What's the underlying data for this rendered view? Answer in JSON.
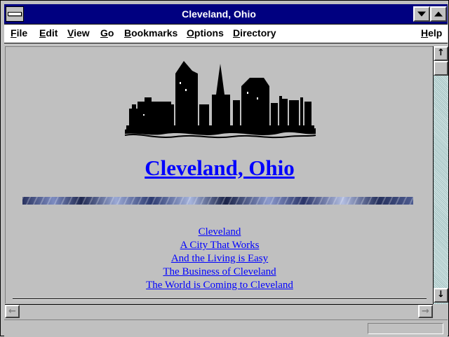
{
  "window": {
    "title": "Cleveland, Ohio"
  },
  "menubar": {
    "items": [
      {
        "label": "File",
        "accel": "F",
        "rest": "ile"
      },
      {
        "label": "Edit",
        "accel": "E",
        "rest": "dit"
      },
      {
        "label": "View",
        "accel": "V",
        "rest": "iew"
      },
      {
        "label": "Go",
        "accel": "G",
        "rest": "o"
      },
      {
        "label": "Bookmarks",
        "accel": "B",
        "rest": "ookmarks"
      },
      {
        "label": "Options",
        "accel": "O",
        "rest": "ptions"
      },
      {
        "label": "Directory",
        "accel": "D",
        "rest": "irectory"
      },
      {
        "label": "Help",
        "accel": "H",
        "rest": "elp"
      }
    ]
  },
  "page": {
    "heading": "Cleveland, Ohio",
    "links": [
      "Cleveland",
      "A City That Works",
      "And the Living is Easy",
      "The Business of Cleveland",
      "The World is Coming to Cleveland"
    ]
  },
  "icons": {
    "system_menu": "system-menu-icon",
    "minimize": "minimize-arrow-icon",
    "maximize": "maximize-arrow-icon",
    "scroll_up": "up-arrow-icon",
    "scroll_down": "down-arrow-icon",
    "scroll_left": "left-arrow-icon",
    "scroll_right": "right-arrow-icon"
  },
  "colors": {
    "title_bar": "#000080",
    "link": "#0000ff",
    "page_background": "#c0c0c0"
  }
}
